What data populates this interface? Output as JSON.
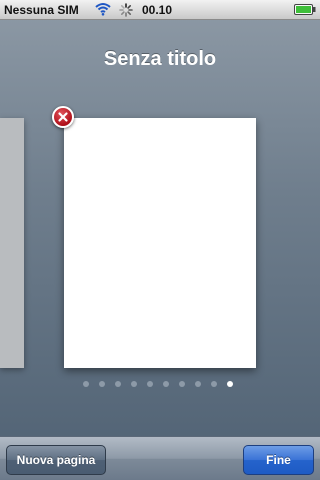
{
  "status_bar": {
    "carrier": "Nessuna SIM",
    "time": "00.10",
    "icons": [
      "wifi-icon",
      "activity-spinner-icon",
      "battery-icon"
    ]
  },
  "title": "Senza titolo",
  "pager": {
    "page_count": 10,
    "current_page": 10
  },
  "toolbar": {
    "new_page_label": "Nuova pagina",
    "done_label": "Fine"
  },
  "colors": {
    "delete_red": "#b0101a",
    "done_blue": "#2563cc",
    "background": "#6f7e8d"
  }
}
